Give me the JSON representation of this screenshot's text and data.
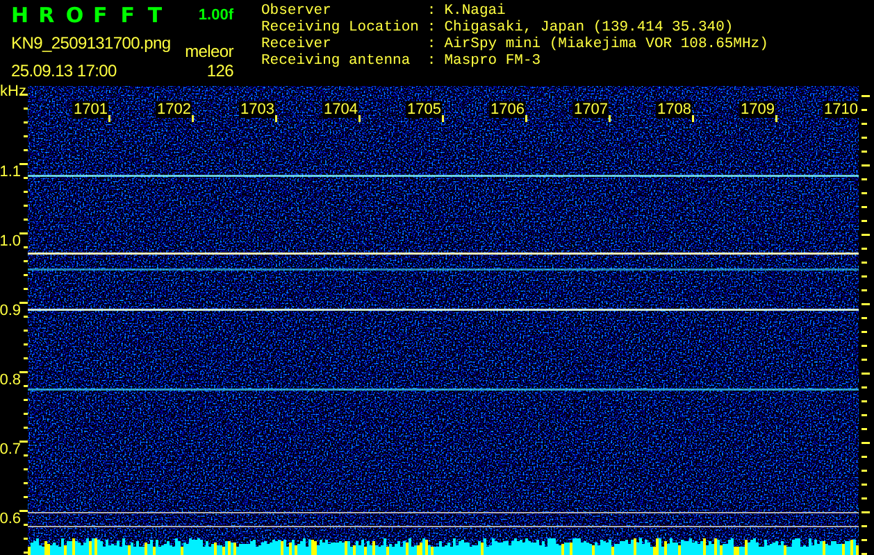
{
  "app": {
    "title_letters": [
      "H",
      "R",
      "O",
      "F",
      "F",
      "T"
    ],
    "version": "1.00f"
  },
  "file": {
    "name": "KN9_2509131700.png",
    "timestamp": "25.09.13 17:00"
  },
  "detection": {
    "label": "meleor",
    "count": "126"
  },
  "station": [
    {
      "label": "Observer",
      "colon": ":",
      "value": "K.Nagai"
    },
    {
      "label": "Receiving Location",
      "colon": ":",
      "value": "Chigasaki, Japan (139.414 35.340)"
    },
    {
      "label": "Receiver",
      "colon": ":",
      "value": "AirSpy mini (Miakejima VOR 108.65MHz)"
    },
    {
      "label": "Receiving antenna",
      "colon": ":",
      "value": "Maspro FM-3"
    }
  ],
  "spectrogram": {
    "unit": "kHz",
    "x_labels": [
      "1701",
      "1702",
      "1703",
      "1704",
      "1705",
      "1706",
      "1707",
      "1708",
      "1709",
      "1710"
    ],
    "y_labels": [
      {
        "value": "1.1"
      },
      {
        "value": "1.0"
      },
      {
        "value": "0.9"
      },
      {
        "value": "0.8"
      },
      {
        "value": "0.7"
      },
      {
        "value": "0.6"
      }
    ]
  }
}
